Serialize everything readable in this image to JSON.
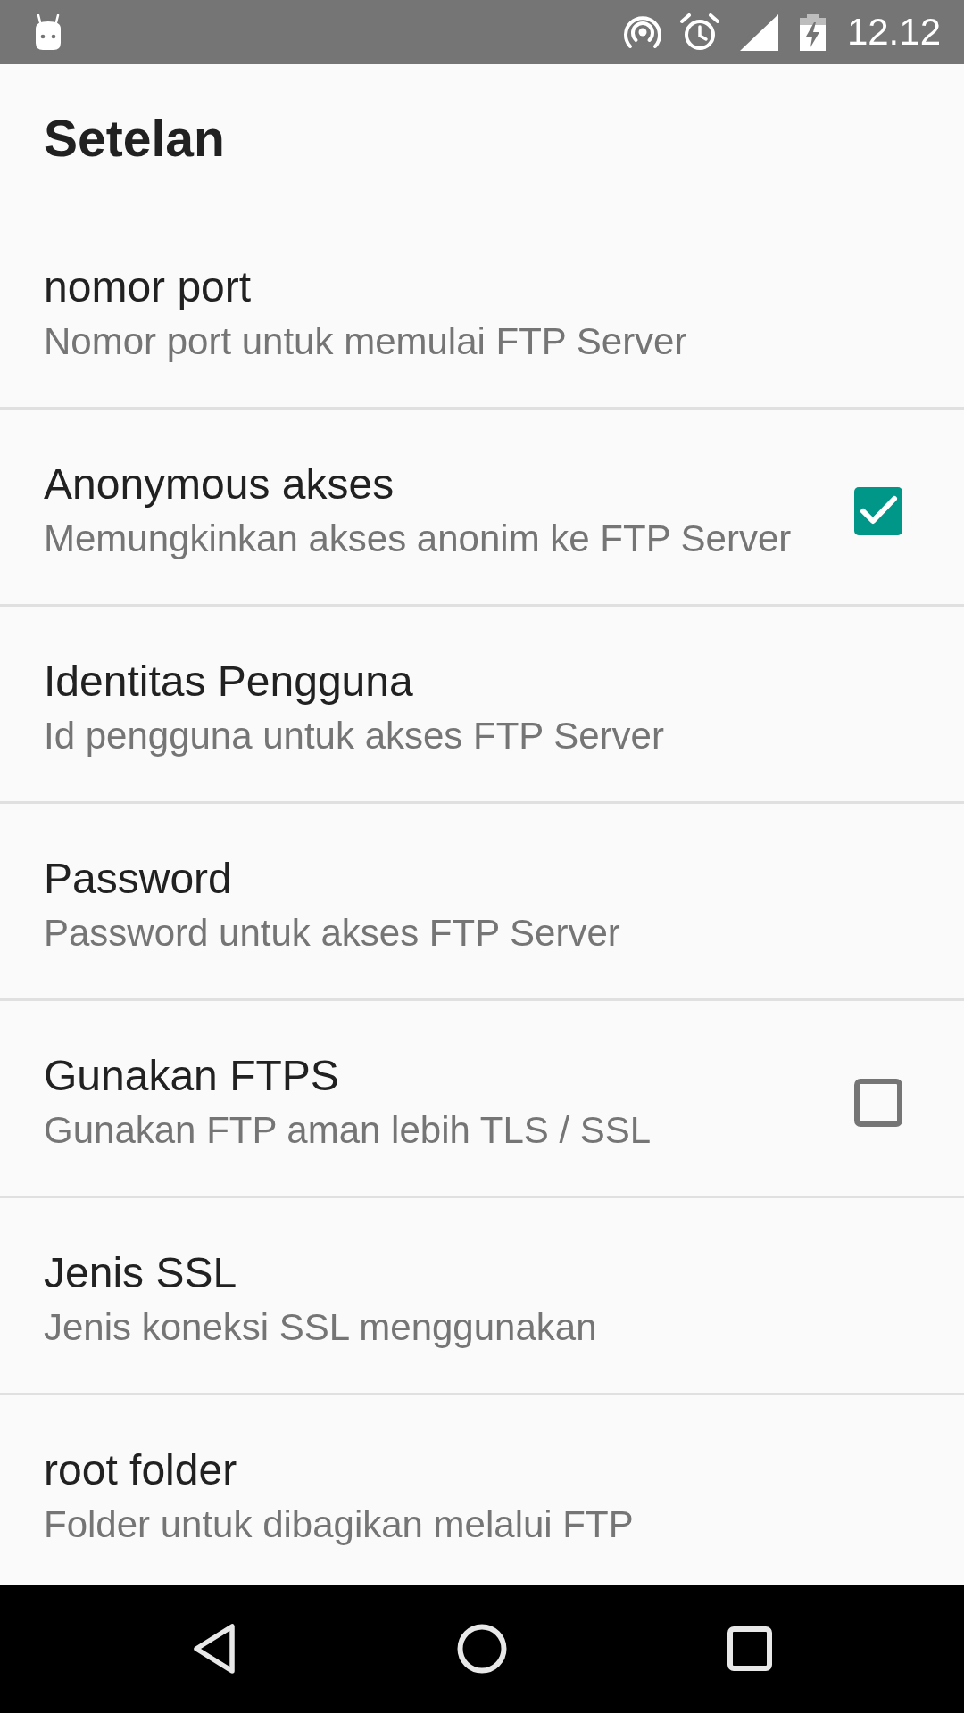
{
  "status_bar": {
    "time": "12.12"
  },
  "title": "Setelan",
  "preferences": [
    {
      "kind": "text",
      "title": "nomor port",
      "summary": "Nomor port untuk memulai FTP Server"
    },
    {
      "kind": "checkbox",
      "title": "Anonymous akses",
      "summary": "Memungkinkan akses anonim ke FTP Server",
      "checked": true
    },
    {
      "kind": "text",
      "title": "Identitas Pengguna",
      "summary": "Id pengguna untuk akses FTP Server"
    },
    {
      "kind": "text",
      "title": "Password",
      "summary": "Password untuk akses FTP Server"
    },
    {
      "kind": "checkbox",
      "title": "Gunakan FTPS",
      "summary": "Gunakan FTP aman lebih TLS / SSL",
      "checked": false
    },
    {
      "kind": "text",
      "title": "Jenis SSL",
      "summary": "Jenis koneksi SSL menggunakan"
    },
    {
      "kind": "text",
      "title": "root folder",
      "summary": "Folder untuk dibagikan melalui FTP"
    }
  ]
}
